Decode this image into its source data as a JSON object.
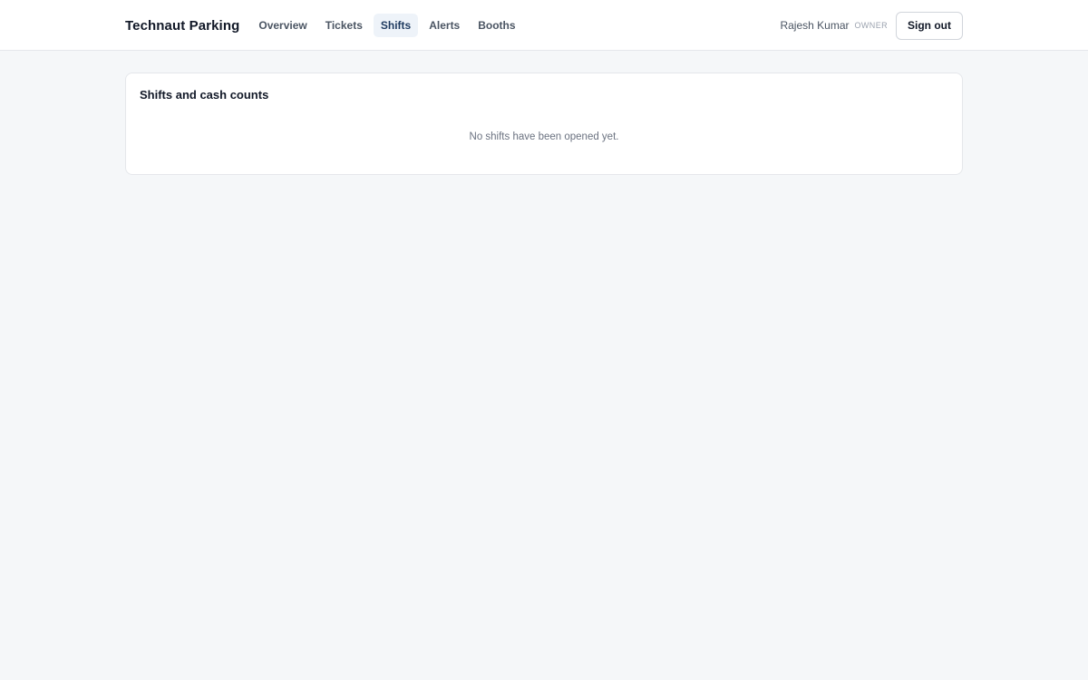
{
  "app": {
    "brand": "Technaut Parking"
  },
  "nav": {
    "items": [
      {
        "label": "Overview",
        "active": false
      },
      {
        "label": "Tickets",
        "active": false
      },
      {
        "label": "Shifts",
        "active": true
      },
      {
        "label": "Alerts",
        "active": false
      },
      {
        "label": "Booths",
        "active": false
      }
    ]
  },
  "user": {
    "name": "Rajesh Kumar",
    "role": "OWNER",
    "signout_label": "Sign out"
  },
  "shifts_card": {
    "title": "Shifts and cash counts",
    "empty_message": "No shifts have been opened yet."
  },
  "colors": {
    "page_background": "#f5f7f9",
    "active_nav_background": "#eef3f9",
    "active_nav_text": "#1e3a5f"
  }
}
